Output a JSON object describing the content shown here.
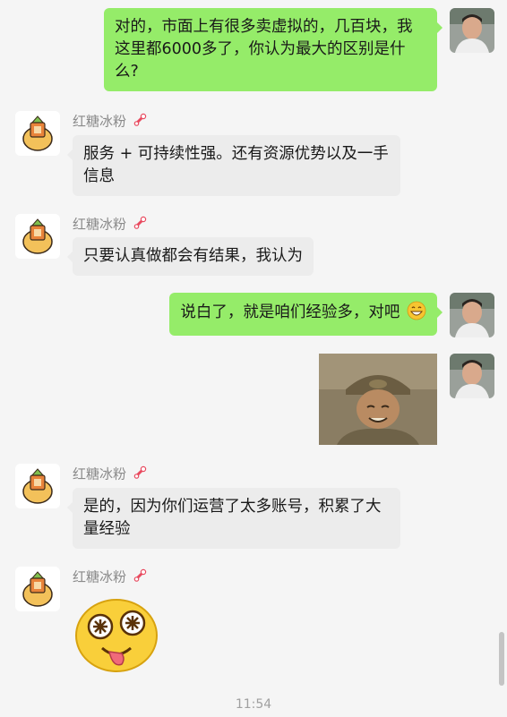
{
  "messages": [
    {
      "from": "self",
      "text": "对的，市面上有很多卖虚拟的，几百块，我这里都6000多了，你认为最大的区别是什么?"
    },
    {
      "from": "other",
      "name": "红糖冰粉",
      "text": "服务 + 可持续性强。还有资源优势以及一手信息"
    },
    {
      "from": "other",
      "name": "红糖冰粉",
      "text": "只要认真做都会有结果，我认为"
    },
    {
      "from": "self",
      "text": "说白了，就是咱们经验多，对吧"
    },
    {
      "from": "self",
      "type": "image",
      "desc": "soldier-photo"
    },
    {
      "from": "other",
      "name": "红糖冰粉",
      "text": "是的，因为你们运营了太多账号，积累了大量经验"
    },
    {
      "from": "other",
      "name": "红糖冰粉",
      "type": "sticker",
      "desc": "dizzy-face-sticker"
    }
  ],
  "timestamp": "11:54",
  "colors": {
    "self_bubble": "#95ec69",
    "other_bubble": "#ececec",
    "background": "#f5f5f5"
  }
}
